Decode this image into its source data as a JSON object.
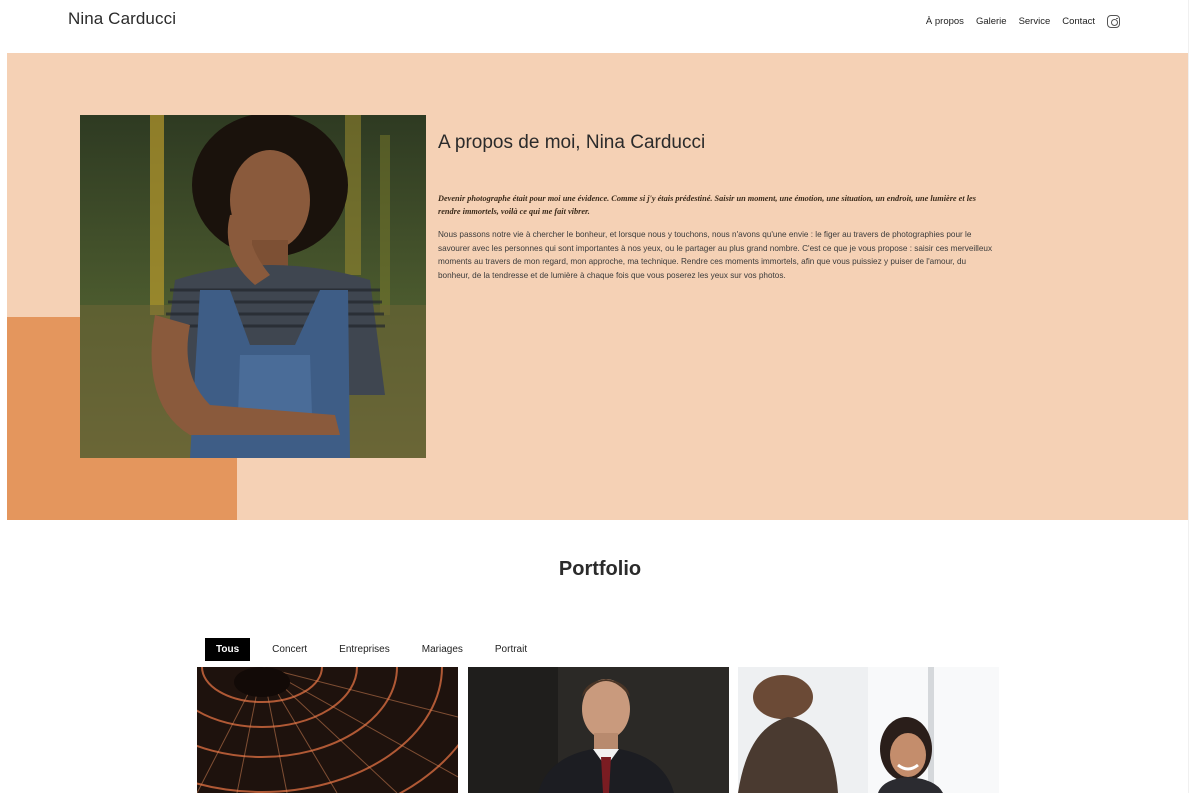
{
  "header": {
    "brand": "Nina Carducci",
    "nav": [
      "À propos",
      "Galerie",
      "Service",
      "Contact"
    ],
    "social_icon": "instagram-icon"
  },
  "about": {
    "title": "A propos de moi, Nina Carducci",
    "lead": "Devenir photographe était pour moi une évidence. Comme si j'y étais prédestiné. Saisir un moment, une émotion, une situation, un endroit, une lumière et les rendre immortels, voilà ce qui me fait vibrer.",
    "body": "Nous passons notre vie à chercher le bonheur, et lorsque nous y touchons, nous n'avons qu'une envie : le figer au travers de photographies pour le savourer avec les personnes qui sont importantes à nos yeux, ou le partager au plus grand nombre. C'est ce que je vous propose : saisir ces merveilleux moments au travers de mon regard, mon approche, ma technique. Rendre ces moments immortels, afin que vous puissiez y puiser de l'amour, du bonheur, de la tendresse et de lumière à chaque fois que vous poserez les yeux sur vos photos."
  },
  "portfolio": {
    "title": "Portfolio",
    "filters": [
      "Tous",
      "Concert",
      "Entreprises",
      "Mariages",
      "Portrait"
    ],
    "active_filter": "Tous"
  },
  "colors": {
    "about_bg": "#f5d1b5",
    "accent": "#e4965d",
    "active_filter_bg": "#000000"
  }
}
